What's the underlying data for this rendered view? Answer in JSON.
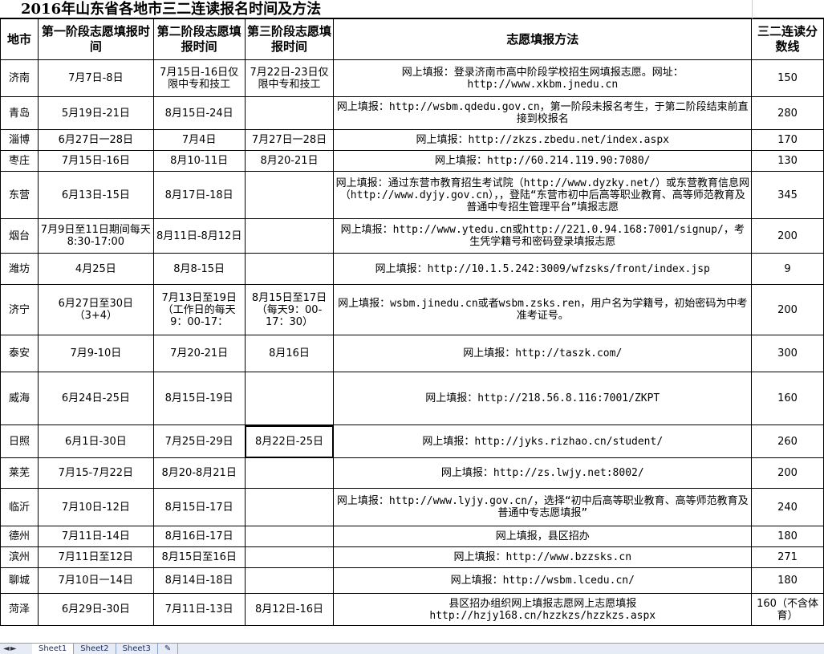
{
  "title": "2016年山东省各地市三二连读报名时间及方法",
  "headers": {
    "city": "地市",
    "stage1": "第一阶段志愿填报时间",
    "stage2": "第二阶段志愿填报时间",
    "stage3": "第三阶段志愿填报时间",
    "method": "志愿填报方法",
    "score": "三二连读分数线"
  },
  "rows": [
    {
      "city": "济南",
      "stage1": "7月7日-8日",
      "stage2": "7月15日-16日仅限中专和技工",
      "stage3": "7月22日-23日仅限中专和技工",
      "method": "网上填报：登录济南市高中阶段学校招生网填报志愿。网址：http://www.xkbm.jnedu.cn",
      "score": "150"
    },
    {
      "city": "青岛",
      "stage1": "5月19日-21日",
      "stage2": "8月15日-24日",
      "stage3": "",
      "method": "网上填报：http://wsbm.qdedu.gov.cn，第一阶段未报名考生，于第二阶段结束前直接到校报名",
      "score": "280"
    },
    {
      "city": "淄博",
      "stage1": "6月27日一28日",
      "stage2": "7月4日",
      "stage3": "7月27日一28日",
      "method": "网上填报：http://zkzs.zbedu.net/index.aspx",
      "score": "170"
    },
    {
      "city": "枣庄",
      "stage1": "7月15日-16日",
      "stage2": "8月10-11日",
      "stage3": "8月20-21日",
      "method": "网上填报：http://60.214.119.90:7080/",
      "score": "130"
    },
    {
      "city": "东营",
      "stage1": "6月13日-15日",
      "stage2": "8月17日-18日",
      "stage3": "",
      "method": "网上填报：通过东营市教育招生考试院（http://www.dyzky.net/）或东营教育信息网（http://www.dyjy.gov.cn），，登陆“东营市初中后高等职业教育、高等师范教育及普通中专招生管理平台”填报志愿",
      "score": "345"
    },
    {
      "city": "烟台",
      "stage1": "7月9日至11日期间每天8:30-17:00",
      "stage2": "8月11日-8月12日",
      "stage3": "",
      "method": "网上填报：http://www.ytedu.cn或http://221.0.94.168:7001/signup/，考生凭学籍号和密码登录填报志愿",
      "score": "200"
    },
    {
      "city": "潍坊",
      "stage1": "4月25日",
      "stage2": "8月8-15日",
      "stage3": "",
      "method": "网上填报：http://10.1.5.242:3009/wfzsks/front/index.jsp",
      "score": "9"
    },
    {
      "city": "济宁",
      "stage1": "6月27日至30日（3+4）",
      "stage2": "7月13日至19日（工作日的每天9：00-17：",
      "stage3": "8月15日至17日（每天9：00-17：30）",
      "method": "网上填报：wsbm.jinedu.cn或者wsbm.zsks.ren，用户名为学籍号，初始密码为中考准考证号。",
      "score": "200"
    },
    {
      "city": "泰安",
      "stage1": "7月9-10日",
      "stage2": "7月20-21日",
      "stage3": "8月16日",
      "method": "网上填报：http://taszk.com/",
      "score": "300"
    },
    {
      "city": "威海",
      "stage1": "6月24日-25日",
      "stage2": "8月15日-19日",
      "stage3": "",
      "method": "网上填报：http://218.56.8.116:7001/ZKPT",
      "score": "160"
    },
    {
      "city": "日照",
      "stage1": "6月1日-30日",
      "stage2": "7月25日-29日",
      "stage3": "8月22日-25日",
      "method": "网上填报：http://jyks.rizhao.cn/student/",
      "score": "260"
    },
    {
      "city": "莱芜",
      "stage1": "7月15-7月22日",
      "stage2": "8月20-8月21日",
      "stage3": "",
      "method": "网上填报：http://zs.lwjy.net:8002/",
      "score": "200"
    },
    {
      "city": "临沂",
      "stage1": "7月10日-12日",
      "stage2": "8月15日-17日",
      "stage3": "",
      "method": "网上填报：http://www.lyjy.gov.cn/，选择“初中后高等职业教育、高等师范教育及普通中专志愿填报”",
      "score": "240"
    },
    {
      "city": "德州",
      "stage1": "7月11日-14日",
      "stage2": "8月16日-17日",
      "stage3": "",
      "method": "网上填报，县区招办",
      "score": "180"
    },
    {
      "city": "滨州",
      "stage1": "7月11日至12日",
      "stage2": "8月15日至16日",
      "stage3": "",
      "method": "网上填报：http://www.bzzsks.cn",
      "score": "271"
    },
    {
      "city": "聊城",
      "stage1": "7月10日一14日",
      "stage2": "8月14日-18日",
      "stage3": "",
      "method": "网上填报：http://wsbm.lcedu.cn/",
      "score": "180"
    },
    {
      "city": "菏泽",
      "stage1": "6月29日-30日",
      "stage2": "7月11日-13日",
      "stage3": "8月12日-16日",
      "method": "县区招办组织网上填报志愿网上志愿填报http://hzjy168.cn/hzzkzs/hzzkzs.aspx",
      "score": "160（不含体育）"
    }
  ],
  "sheet_tabs": [
    "Sheet1",
    "Sheet2",
    "Sheet3"
  ],
  "nav_arrows": "◄ ►",
  "colors": {
    "link": "#0000ee",
    "tab_bar": "#e6ebf5"
  }
}
